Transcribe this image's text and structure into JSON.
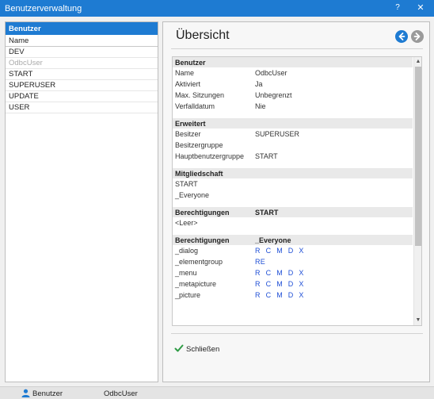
{
  "window": {
    "title": "Benutzerverwaltung",
    "help_label": "?",
    "close_label": "✕"
  },
  "userlist": {
    "header": "Benutzer",
    "column": "Name",
    "items": [
      "DEV",
      "OdbcUser",
      "START",
      "SUPERUSER",
      "UPDATE",
      "USER"
    ]
  },
  "overview": {
    "title": "Übersicht",
    "sections": {
      "benutzer": {
        "header": "Benutzer",
        "rows": [
          {
            "label": "Name",
            "value": "OdbcUser"
          },
          {
            "label": "Aktiviert",
            "value": "Ja"
          },
          {
            "label": "Max. Sitzungen",
            "value": "Unbegrenzt"
          },
          {
            "label": "Verfalldatum",
            "value": "Nie"
          }
        ]
      },
      "erweitert": {
        "header": "Erweitert",
        "rows": [
          {
            "label": "Besitzer",
            "value": "SUPERUSER"
          },
          {
            "label": "Besitzergruppe",
            "value": ""
          },
          {
            "label": "Hauptbenutzergruppe",
            "value": "START"
          }
        ]
      },
      "mitgliedschaft": {
        "header": "Mitgliedschaft",
        "items": [
          "START",
          "_Everyone"
        ]
      },
      "berechtigungen_start": {
        "header": "Berechtigungen",
        "group": "START",
        "empty": "<Leer>"
      },
      "berechtigungen_everyone": {
        "header": "Berechtigungen",
        "group": "_Everyone",
        "rows": [
          {
            "label": "_dialog",
            "perms": "R C M D X"
          },
          {
            "label": "_elementgroup",
            "perms": "RE"
          },
          {
            "label": "_menu",
            "perms": "R C M D X"
          },
          {
            "label": "_metapicture",
            "perms": "R C M D X"
          },
          {
            "label": "_picture",
            "perms": "R C M D X"
          }
        ]
      }
    },
    "close_label": "Schließen"
  },
  "statusbar": {
    "section_label": "Benutzer",
    "current_user": "OdbcUser"
  },
  "colors": {
    "accent": "#1e7bd2",
    "permission": "#1f4fd6",
    "close_check": "#2e9b45"
  }
}
